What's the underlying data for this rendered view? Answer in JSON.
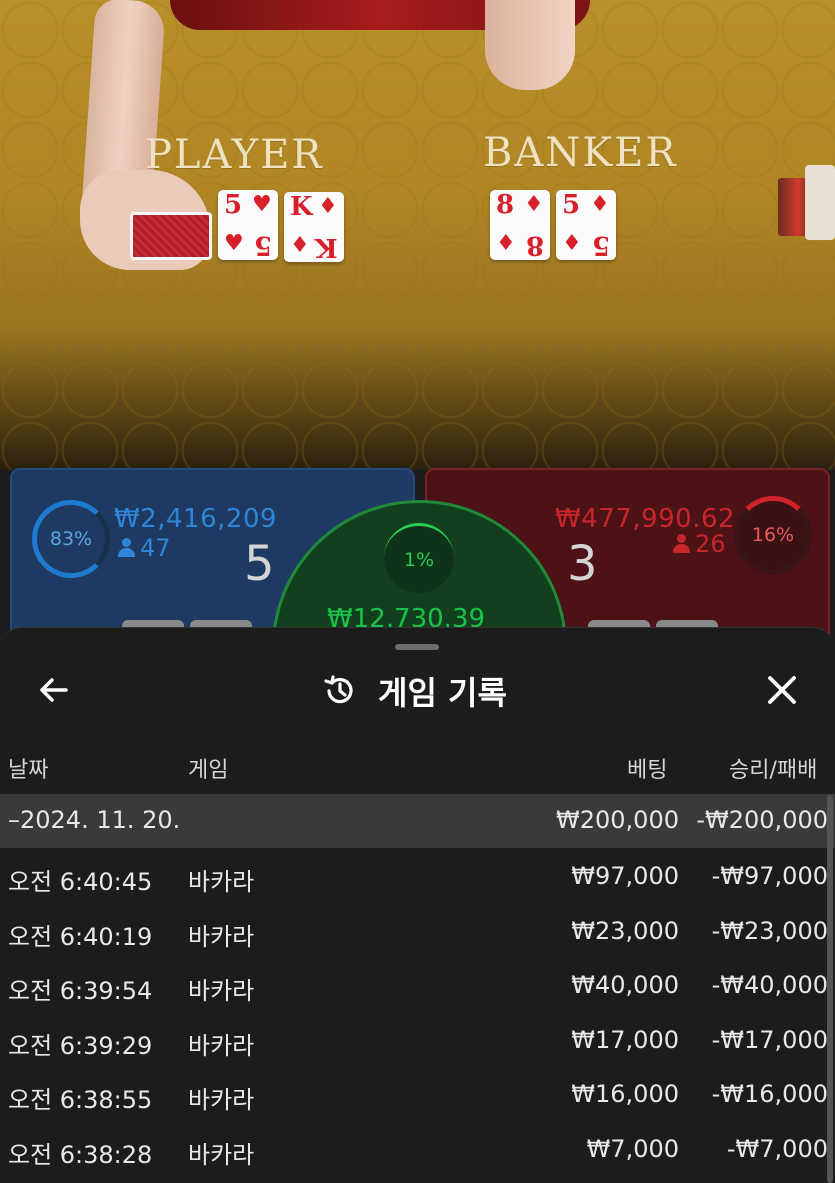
{
  "table": {
    "player_label": "PLAYER",
    "banker_label": "BANKER",
    "player_cards": [
      {
        "rank": "5",
        "suit": "♥"
      },
      {
        "rank": "K",
        "suit": "♦"
      }
    ],
    "banker_cards": [
      {
        "rank": "8",
        "suit": "♦"
      },
      {
        "rank": "5",
        "suit": "♦"
      }
    ]
  },
  "betting": {
    "player": {
      "percent": "83%",
      "amount": "₩2,416,209",
      "users": "47",
      "score": "5",
      "color": "#2f86d8"
    },
    "banker": {
      "percent": "16%",
      "amount": "₩477,990.62",
      "users": "26",
      "score": "3",
      "color": "#c9262c"
    },
    "tie": {
      "percent": "1%",
      "amount": "₩12,730.39",
      "color": "#1bc24a"
    }
  },
  "history": {
    "title": "게임 기록",
    "back_icon": "arrow-left-icon",
    "close_icon": "close-icon",
    "columns": {
      "date": "날짜",
      "game": "게임",
      "bet": "베팅",
      "win_loss": "승리/패배"
    },
    "date_group": {
      "date": "–2024. 11. 20.",
      "bet": "₩200,000",
      "win_loss": "-₩200,000"
    },
    "rows": [
      {
        "time": "오전 6:40:45",
        "game": "바카라",
        "bet": "₩97,000",
        "win_loss": "-₩97,000"
      },
      {
        "time": "오전 6:40:19",
        "game": "바카라",
        "bet": "₩23,000",
        "win_loss": "-₩23,000"
      },
      {
        "time": "오전 6:39:54",
        "game": "바카라",
        "bet": "₩40,000",
        "win_loss": "-₩40,000"
      },
      {
        "time": "오전 6:39:29",
        "game": "바카라",
        "bet": "₩17,000",
        "win_loss": "-₩17,000"
      },
      {
        "time": "오전 6:38:55",
        "game": "바카라",
        "bet": "₩16,000",
        "win_loss": "-₩16,000"
      },
      {
        "time": "오전 6:38:28",
        "game": "바카라",
        "bet": "₩7,000",
        "win_loss": "-₩7,000"
      }
    ]
  }
}
